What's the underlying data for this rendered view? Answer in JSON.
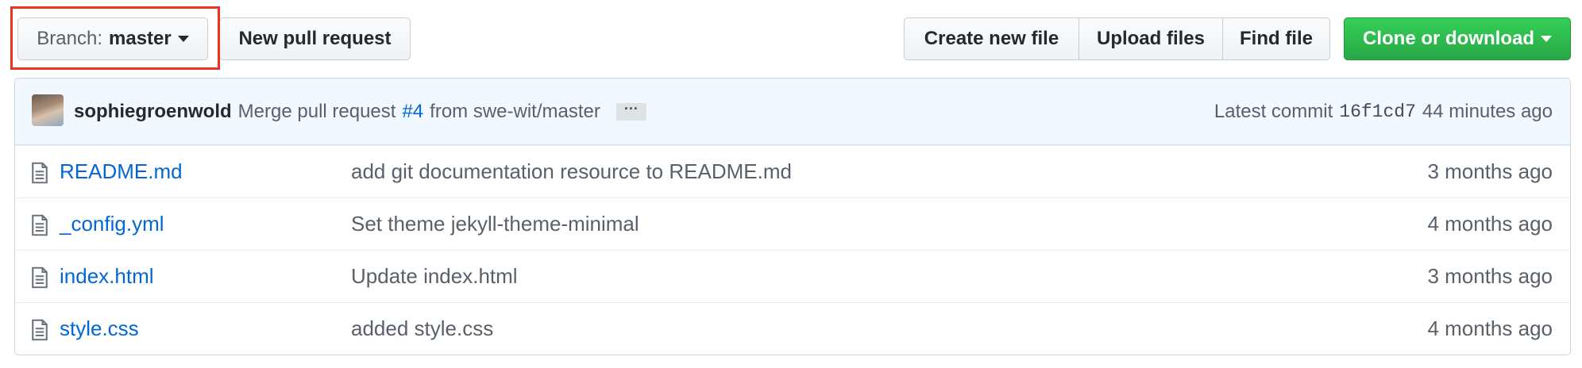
{
  "toolbar": {
    "branch_prefix": "Branch:",
    "branch_name": "master",
    "new_pull_request": "New pull request",
    "create_new_file": "Create new file",
    "upload_files": "Upload files",
    "find_file": "Find file",
    "clone_or_download": "Clone or download"
  },
  "commit": {
    "author": "sophiegroenwold",
    "message_prefix": "Merge pull request",
    "pr_number": "#4",
    "message_suffix": "from swe-wit/master",
    "ellipsis": "···",
    "latest_label": "Latest commit",
    "sha": "16f1cd7",
    "time": "44 minutes ago"
  },
  "files": [
    {
      "name": "README.md",
      "message": "add git documentation resource to README.md",
      "age": "3 months ago"
    },
    {
      "name": "_config.yml",
      "message": "Set theme jekyll-theme-minimal",
      "age": "4 months ago"
    },
    {
      "name": "index.html",
      "message": "Update index.html",
      "age": "3 months ago"
    },
    {
      "name": "style.css",
      "message": "added style.css",
      "age": "4 months ago"
    }
  ],
  "colors": {
    "highlight": "#ea3323",
    "link": "#0366d6",
    "green_button": "#2ea44f",
    "commit_bar": "#f1f8ff"
  }
}
